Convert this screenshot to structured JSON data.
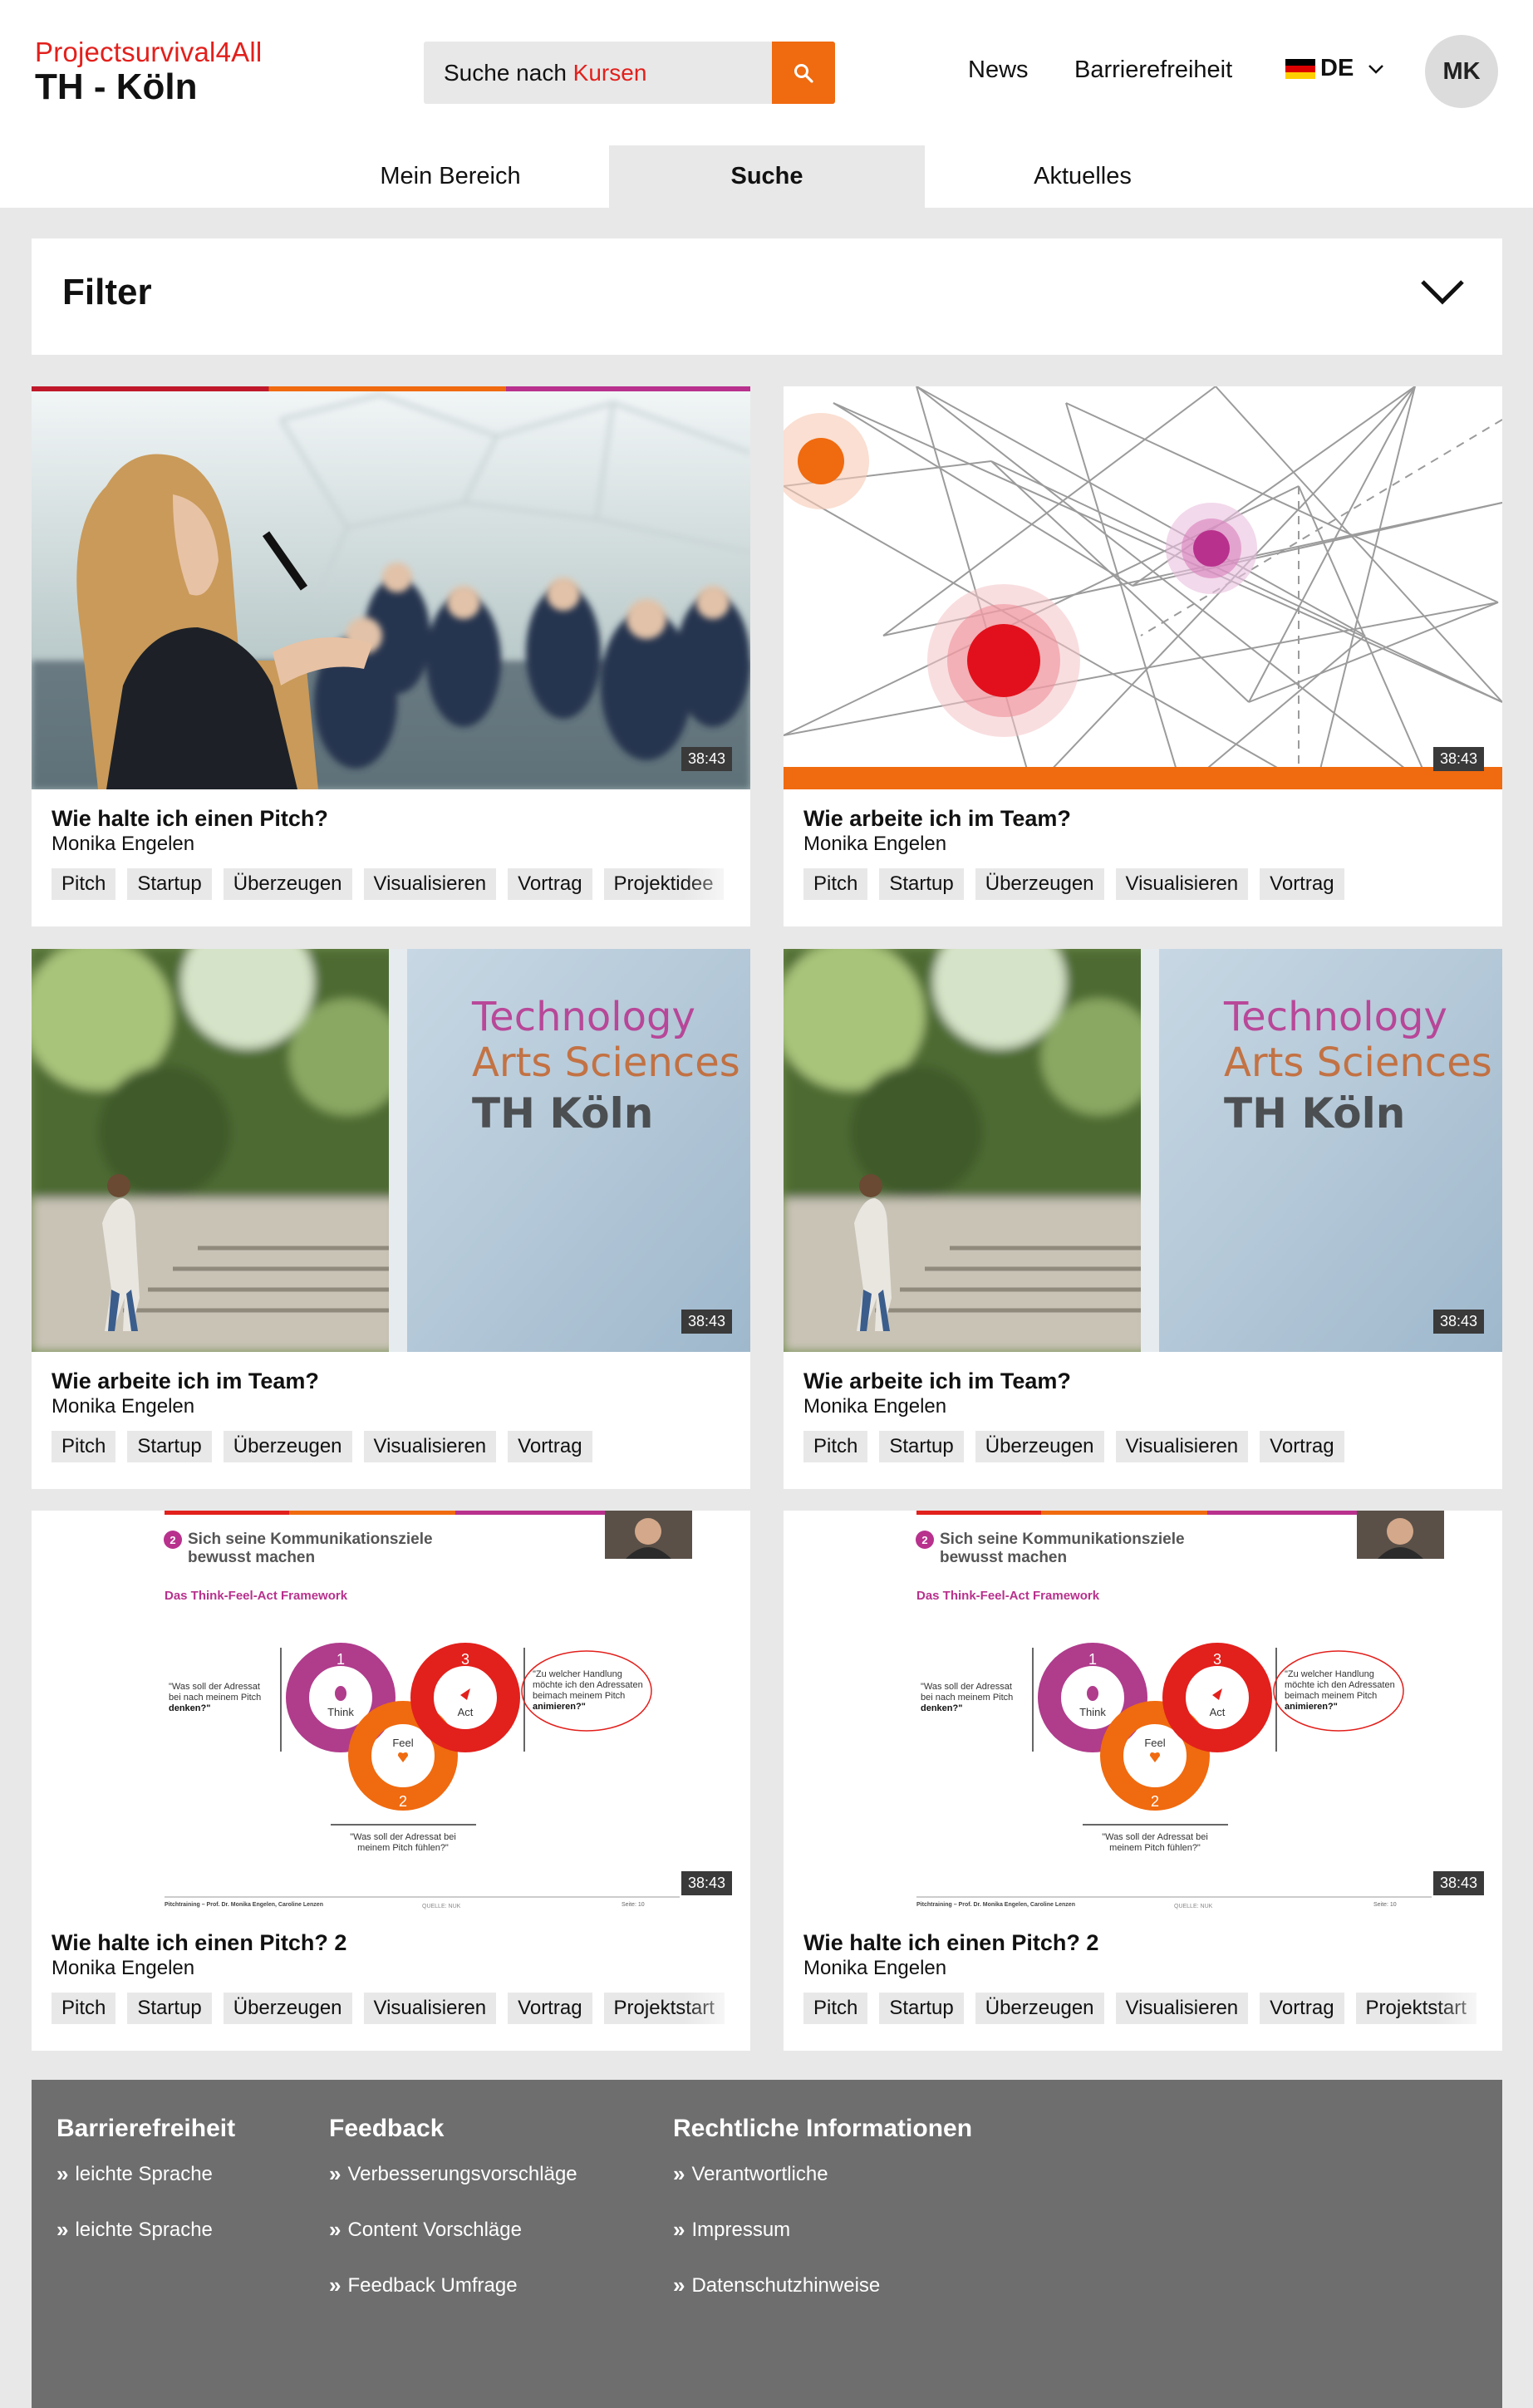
{
  "brand": {
    "line1": "Projectsurvival4All",
    "line2": "TH - Köln"
  },
  "search": {
    "placeholder_prefix": "Suche nach ",
    "placeholder_keyword": "Kursen"
  },
  "topnav": {
    "news": "News",
    "accessibility": "Barrierefreiheit",
    "language": "DE",
    "avatar_initials": "MK"
  },
  "tabs": [
    {
      "label": "Mein Bereich"
    },
    {
      "label": "Suche"
    },
    {
      "label": "Aktuelles"
    }
  ],
  "filter": {
    "title": "Filter"
  },
  "cards": [
    {
      "title": "Wie halte ich einen Pitch?",
      "author": "Monika Engelen",
      "duration": "38:43",
      "thumb": "speaker",
      "tags": [
        "Pitch",
        "Startup",
        "Überzeugen",
        "Visualisieren",
        "Vortrag",
        "Projektidee"
      ]
    },
    {
      "title": "Wie arbeite ich im Team?",
      "author": "Monika Engelen",
      "duration": "38:43",
      "thumb": "network",
      "tags": [
        "Pitch",
        "Startup",
        "Überzeugen",
        "Visualisieren",
        "Vortrag"
      ]
    },
    {
      "title": "Wie arbeite ich im Team?",
      "author": "Monika Engelen",
      "duration": "38:43",
      "thumb": "campus",
      "tags": [
        "Pitch",
        "Startup",
        "Überzeugen",
        "Visualisieren",
        "Vortrag"
      ]
    },
    {
      "title": "Wie arbeite ich im Team?",
      "author": "Monika Engelen",
      "duration": "38:43",
      "thumb": "campus",
      "tags": [
        "Pitch",
        "Startup",
        "Überzeugen",
        "Visualisieren",
        "Vortrag"
      ]
    },
    {
      "title": "Wie halte ich einen Pitch? 2",
      "author": "Monika Engelen",
      "duration": "38:43",
      "thumb": "slide",
      "tags": [
        "Pitch",
        "Startup",
        "Überzeugen",
        "Visualisieren",
        "Vortrag",
        "Projektstart"
      ]
    },
    {
      "title": "Wie halte ich einen Pitch? 2",
      "author": "Monika Engelen",
      "duration": "38:43",
      "thumb": "slide",
      "tags": [
        "Pitch",
        "Startup",
        "Überzeugen",
        "Visualisieren",
        "Vortrag",
        "Projektstart"
      ]
    }
  ],
  "thumb_text": {
    "campus": {
      "line1": "Technology",
      "line2": "Arts Sciences",
      "line3": "TH Köln"
    },
    "slide": {
      "heading_num": "2",
      "heading": "Sich seine Kommunikationsziele",
      "heading2": "bewusst machen",
      "subheading": "Das Think-Feel-Act Framework",
      "think_label": "Think",
      "feel_label": "Feel",
      "act_label": "Act",
      "num1": "1",
      "num2": "2",
      "num3": "3",
      "left_q1": "\"Was soll der Adressat",
      "left_q2": "bei nach meinem Pitch",
      "left_q3": "denken?\"",
      "right_q1": "\"Zu welcher Handlung",
      "right_q2": "möchte ich den Adressaten",
      "right_q3": "beimach meinem Pitch",
      "right_q4": "animieren?\"",
      "bottom_q1": "\"Was soll der Adressat bei",
      "bottom_q2": "meinem Pitch fühlen?\"",
      "footer_left": "Pitchtraining – Prof. Dr. Monika Engelen, Caroline Lenzen",
      "footer_mid": "QUELLE: NUK",
      "footer_right": "Seite: 10"
    }
  },
  "footer": {
    "col1": {
      "heading": "Barrierefreiheit",
      "links": [
        "leichte Sprache",
        "leichte Sprache"
      ]
    },
    "col2": {
      "heading": "Feedback",
      "links": [
        "Verbesserungsvorschläge",
        "Content Vorschläge",
        "Feedback Umfrage"
      ]
    },
    "col3": {
      "heading": "Rechtliche Informationen",
      "links": [
        "Verantwortliche",
        "Impressum",
        "Datenschutzhinweise"
      ]
    }
  },
  "colors": {
    "accent": "#f06a0f",
    "brand_red": "#e2201c",
    "magenta": "#b8318d",
    "footer_bg": "#6e6e6e"
  }
}
